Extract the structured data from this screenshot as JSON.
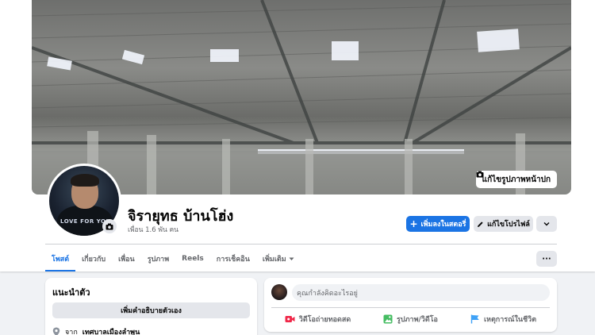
{
  "cover": {
    "edit_label": "แก้ไขรูปภาพหน้าปก",
    "camera_icon": "camera-icon"
  },
  "profile": {
    "name": "จิรายุทธ บ้านโฮ่ง",
    "friends": "เพื่อน 1.6 พัน คน",
    "avatar_text": "LOVE FOR YOU"
  },
  "actions": {
    "add_story": "เพิ่มลงในสตอรี่",
    "edit_profile": "แก้ไขโปรไฟล์",
    "more_icon": "chevron-down-icon"
  },
  "tabs": [
    {
      "label": "โพสต์"
    },
    {
      "label": "เกี่ยวกับ"
    },
    {
      "label": "เพื่อน"
    },
    {
      "label": "รูปภาพ"
    },
    {
      "label": "Reels"
    },
    {
      "label": "การเช็คอิน"
    },
    {
      "label": "เพิ่มเติม"
    }
  ],
  "tabs_more": "···",
  "intro": {
    "title": "แนะนำตัว",
    "bio_button": "เพิ่มคำอธิบายตัวเอง",
    "from_prefix": "จาก",
    "from_place": "เทศบาลเมืองลำพูน"
  },
  "composer": {
    "placeholder": "คุณกำลังคิดอะไรอยู่",
    "live": "วิดีโอถ่ายทอดสด",
    "photo": "รูปภาพ/วิดีโอ",
    "life_event": "เหตุการณ์ในชีวิต"
  },
  "colors": {
    "accent": "#1b74e4",
    "live": "#f02849",
    "photo": "#45bd62",
    "event": "#3ea2f7"
  }
}
